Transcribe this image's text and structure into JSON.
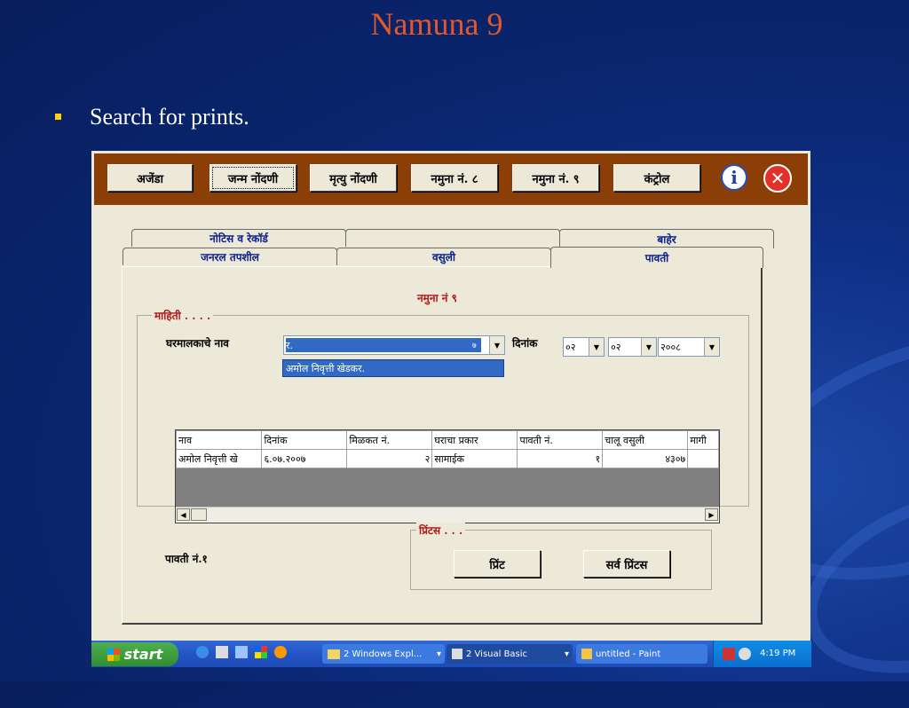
{
  "slide": {
    "title": "Namuna 9",
    "bullet": "Search for prints."
  },
  "toolbar": {
    "buttons": [
      "अजेंडा",
      "जन्म नोंदणी",
      "मृत्यु नोंदणी",
      "नमुना नं. ८",
      "नमुना नं. ९",
      "कंट्रोल"
    ],
    "info_icon": "i",
    "close_icon": "✕"
  },
  "tabs": {
    "row_back": [
      "नोटिस व रेकॉर्ड",
      "",
      "बाहेर"
    ],
    "row_front": [
      "जनरल तपशील",
      "वसुली",
      "पावती"
    ]
  },
  "form": {
    "heading": "नमुना नं ९",
    "info_legend": "माहिती . . . .",
    "owner_label": "घरमालकाचे नाव",
    "owner_value": "र.",
    "owner_suffix": "७",
    "owner_suggestion": "अमोल निवृत्ती खेडकर.",
    "date_label": "दिनांक",
    "date_day": "०२",
    "date_month": "०२",
    "date_year": "२००८",
    "grid_headers": [
      "नाव",
      "दिनांक",
      "मिळकत नं.",
      "घराचा प्रकार",
      "पावती नं.",
      "चालू वसुली",
      "मागी"
    ],
    "grid_rows": [
      [
        "अमोल निवृत्ती खे",
        "६.०७.२००७",
        "२",
        "सामाईक",
        "१",
        "४३०७",
        ""
      ]
    ],
    "receipt_label": "पावती नं.१",
    "prints_legend": "प्रिंटस . . .",
    "print_button": "प्रिंट",
    "all_prints_button": "सर्व प्रिंटस"
  },
  "taskbar": {
    "start": "start",
    "tasks": [
      "2 Windows Expl...",
      "2 Visual Basic",
      "untitled - Paint"
    ],
    "time": "4:19 PM"
  }
}
